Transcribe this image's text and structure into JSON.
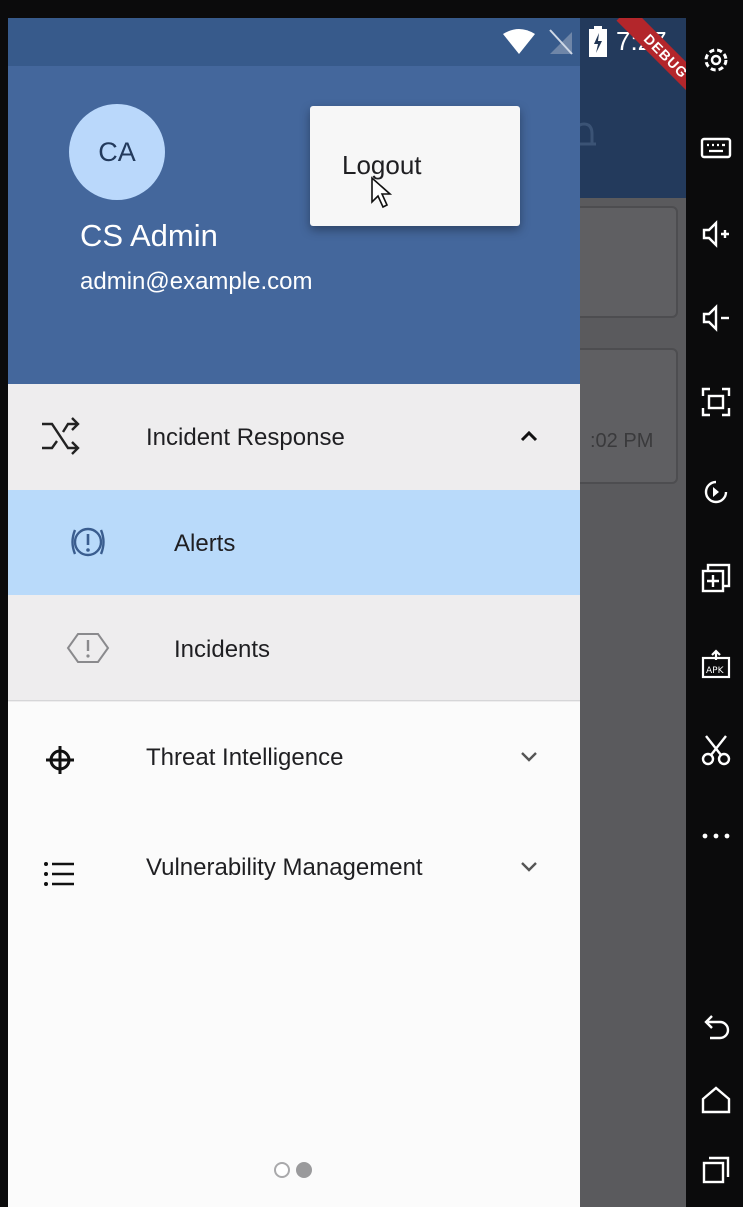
{
  "status_bar": {
    "time": "7:27",
    "debug_banner": "DEBUG"
  },
  "drawer": {
    "header": {
      "avatar_initials": "CA",
      "user_name": "CS Admin",
      "user_email": "admin@example.com"
    },
    "menu": {
      "incident_response": {
        "label": "Incident Response",
        "expanded": true
      },
      "alerts": {
        "label": "Alerts",
        "selected": true
      },
      "incidents": {
        "label": "Incidents"
      },
      "threat_intelligence": {
        "label": "Threat Intelligence",
        "expanded": false
      },
      "vulnerability_management": {
        "label": "Vulnerability Management",
        "expanded": false
      }
    },
    "page_indicator": {
      "count": 2,
      "active_index": 1
    }
  },
  "popup_menu": {
    "logout_label": "Logout"
  },
  "background_app": {
    "partial_time": ":02 PM"
  },
  "colors": {
    "header_blue": "#44679c",
    "app_bar_dark": "#233a5c",
    "selected_item": "#b9dafa",
    "avatar_light_blue": "#bad8fb",
    "debug_red": "#b3262b"
  },
  "emulator_toolbar": {
    "icons": [
      "gear-icon",
      "keyboard-icon",
      "volume-up-icon",
      "volume-down-icon",
      "screenshot-frame-icon",
      "rotate-icon",
      "add-window-icon",
      "apk-install-icon",
      "scissors-icon",
      "more-icon",
      "back-icon",
      "home-icon",
      "recents-icon"
    ]
  }
}
